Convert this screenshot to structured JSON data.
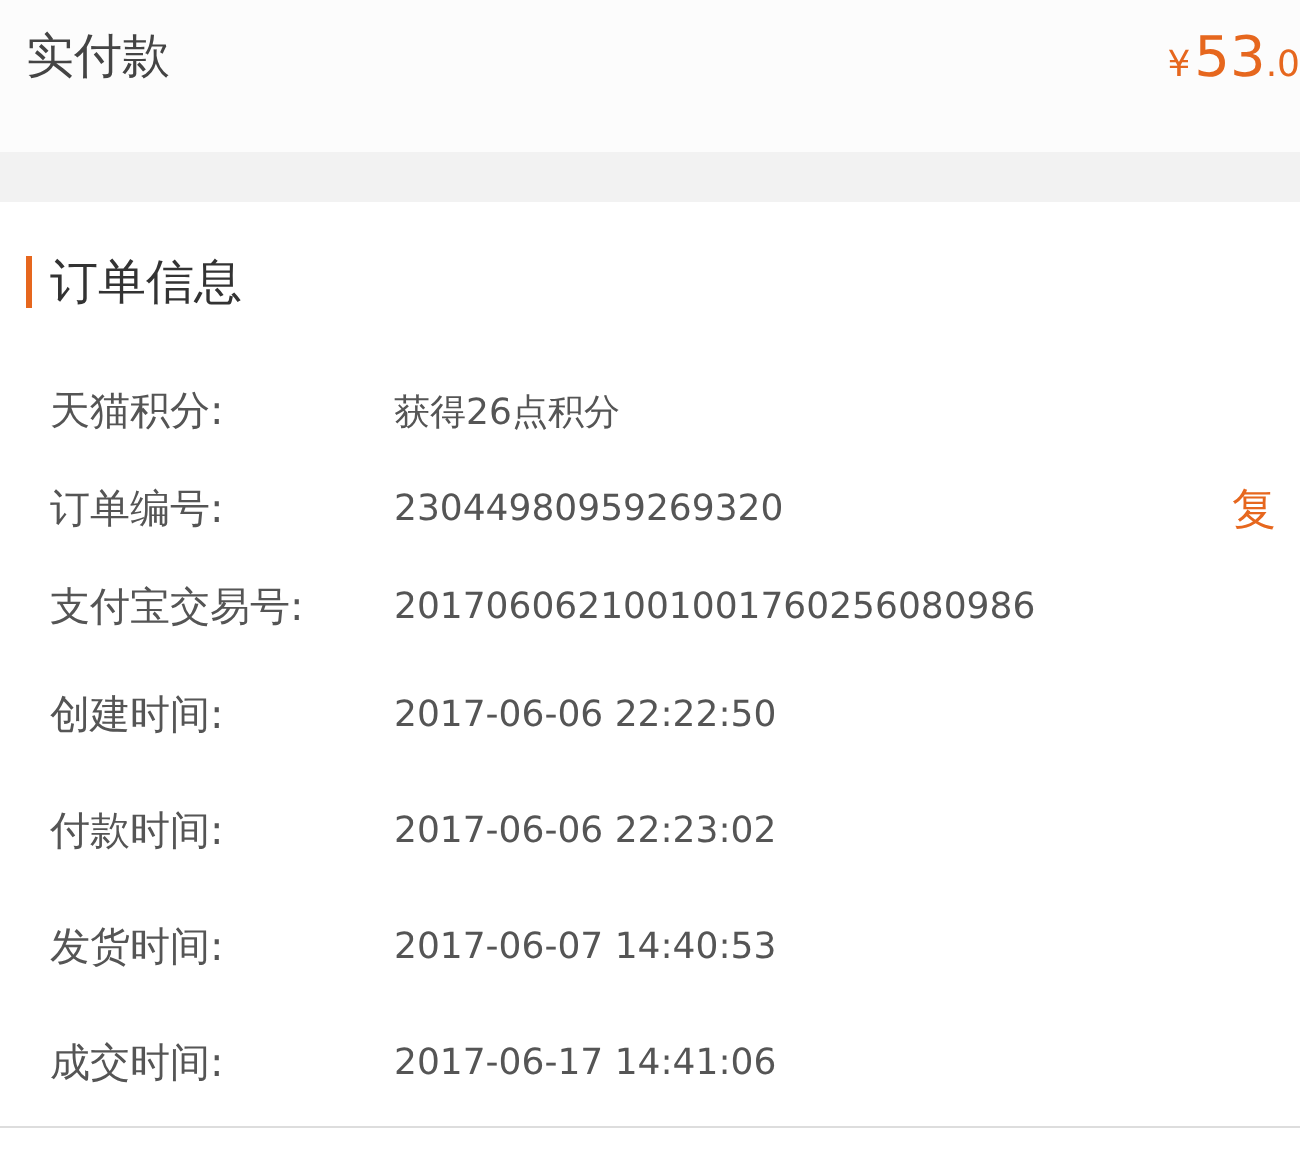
{
  "payment": {
    "label": "实付款",
    "currency": "¥",
    "amount": "53",
    "decimals": ".0"
  },
  "order_info": {
    "title": "订单信息",
    "rows": [
      {
        "label": "天猫积分:",
        "value": "获得26点积分"
      },
      {
        "label": "订单编号:",
        "value": "23044980959269320",
        "action": "复"
      },
      {
        "label": "支付宝交易号:",
        "value": "2017060621001001760256080986"
      },
      {
        "label": "创建时间:",
        "value": "2017-06-06 22:22:50"
      },
      {
        "label": "付款时间:",
        "value": "2017-06-06 22:23:02"
      },
      {
        "label": "发货时间:",
        "value": "2017-06-07 14:40:53"
      },
      {
        "label": "成交时间:",
        "value": "2017-06-17 14:41:06"
      }
    ]
  }
}
